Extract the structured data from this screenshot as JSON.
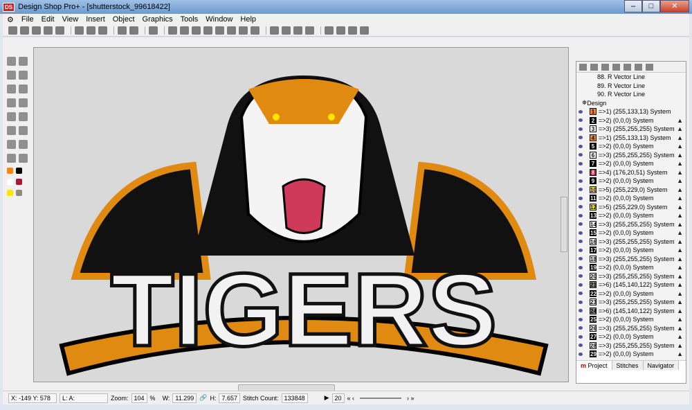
{
  "window": {
    "app_icon": "DS",
    "title": "Design Shop Pro+ - [shutterstock_99618422]",
    "min": "–",
    "max": "□",
    "close": "✕"
  },
  "menu": [
    "File",
    "Edit",
    "View",
    "Insert",
    "Object",
    "Graphics",
    "Tools",
    "Window",
    "Help"
  ],
  "canvas": {
    "artwork_text": "TIGERS",
    "colors": {
      "orange": "#ff850d",
      "black": "#000000",
      "white": "#ffffff",
      "red": "#b01433",
      "yellow": "#ffe500",
      "gray": "#918c7a"
    }
  },
  "panel": {
    "vector_lines": [
      "88. R Vector Line",
      "89. R Vector Line",
      "90. R Vector Line"
    ],
    "design_label": "Design",
    "colors": [
      {
        "n": "1",
        "t": "=>1) (255,133,13) System",
        "c": "#ff850d"
      },
      {
        "n": "2",
        "t": "=>2) (0,0,0) System",
        "c": "#000000"
      },
      {
        "n": "3",
        "t": "=>3) (255,255,255) System",
        "c": "#ffffff"
      },
      {
        "n": "4",
        "t": "=>1) (255,133,13) System",
        "c": "#ff850d"
      },
      {
        "n": "5",
        "t": "=>2) (0,0,0) System",
        "c": "#000000"
      },
      {
        "n": "6",
        "t": "=>3) (255,255,255) System",
        "c": "#ffffff"
      },
      {
        "n": "7",
        "t": "=>2) (0,0,0) System",
        "c": "#000000"
      },
      {
        "n": "8",
        "t": "=>4) (176,20,51) System",
        "c": "#b01433"
      },
      {
        "n": "9",
        "t": "=>2) (0,0,0) System",
        "c": "#000000"
      },
      {
        "n": "10",
        "t": "=>5) (255,229,0) System",
        "c": "#ffe500"
      },
      {
        "n": "11",
        "t": "=>2) (0,0,0) System",
        "c": "#000000"
      },
      {
        "n": "12",
        "t": "=>5) (255,229,0) System",
        "c": "#ffe500"
      },
      {
        "n": "13",
        "t": "=>2) (0,0,0) System",
        "c": "#000000"
      },
      {
        "n": "14",
        "t": "=>3) (255,255,255) System",
        "c": "#ffffff"
      },
      {
        "n": "15",
        "t": "=>2) (0,0,0) System",
        "c": "#000000"
      },
      {
        "n": "16",
        "t": "=>3) (255,255,255) System",
        "c": "#ffffff"
      },
      {
        "n": "17",
        "t": "=>2) (0,0,0) System",
        "c": "#000000"
      },
      {
        "n": "18",
        "t": "=>3) (255,255,255) System",
        "c": "#ffffff"
      },
      {
        "n": "19",
        "t": "=>2) (0,0,0) System",
        "c": "#000000"
      },
      {
        "n": "20",
        "t": "=>3) (255,255,255) System",
        "c": "#ffffff"
      },
      {
        "n": "21",
        "t": "=>6) (145,140,122) System",
        "c": "#918c7a"
      },
      {
        "n": "22",
        "t": "=>2) (0,0,0) System",
        "c": "#000000"
      },
      {
        "n": "23",
        "t": "=>3) (255,255,255) System",
        "c": "#ffffff"
      },
      {
        "n": "24",
        "t": "=>6) (145,140,122) System",
        "c": "#918c7a"
      },
      {
        "n": "25",
        "t": "=>2) (0,0,0) System",
        "c": "#000000"
      },
      {
        "n": "26",
        "t": "=>3) (255,255,255) System",
        "c": "#ffffff"
      },
      {
        "n": "27",
        "t": "=>2) (0,0,0) System",
        "c": "#000000"
      },
      {
        "n": "28",
        "t": "=>3) (255,255,255) System",
        "c": "#ffffff"
      },
      {
        "n": "29",
        "t": "=>2) (0,0,0) System",
        "c": "#000000"
      }
    ],
    "tabs": [
      "Project",
      "Stitches",
      "Navigator"
    ]
  },
  "status": {
    "xy": "X: -149  Y: 578",
    "layer": "L: A:",
    "zoom_label": "Zoom:",
    "zoom": "104",
    "zoom_unit": "%",
    "w_label": "W:",
    "w": "11.299",
    "h_label": "H:",
    "h": "7.657",
    "stitch_label": "Stitch Count:",
    "stitch_count": "133848",
    "step": "20"
  }
}
